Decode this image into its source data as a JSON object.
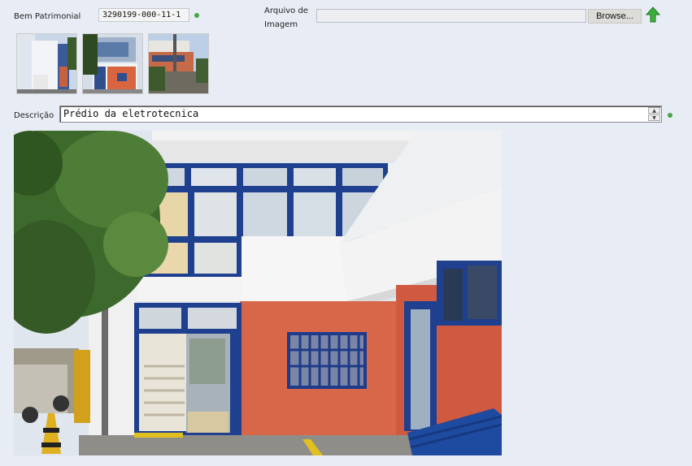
{
  "form": {
    "bem_label": "Bem Patrimonial",
    "bem_value": "3290199-000-11-1",
    "arquivo_label_line1": "Arquivo de",
    "arquivo_label_line2": "Imagem",
    "browse_label": "Browse...",
    "descricao_label": "Descrição",
    "descricao_value": "Prédio da eletrotecnica"
  },
  "icons": {
    "upload": "upload-arrow-icon",
    "required": "required-dot-icon",
    "spin_up": "▲",
    "spin_down": "▼"
  },
  "thumbnails": [
    {
      "name": "thumbnail-1"
    },
    {
      "name": "thumbnail-2"
    },
    {
      "name": "thumbnail-3"
    }
  ],
  "colors": {
    "required_dot": "#49a64a",
    "upload_arrow": "#3bb03b",
    "background": "#e8ecf4"
  }
}
